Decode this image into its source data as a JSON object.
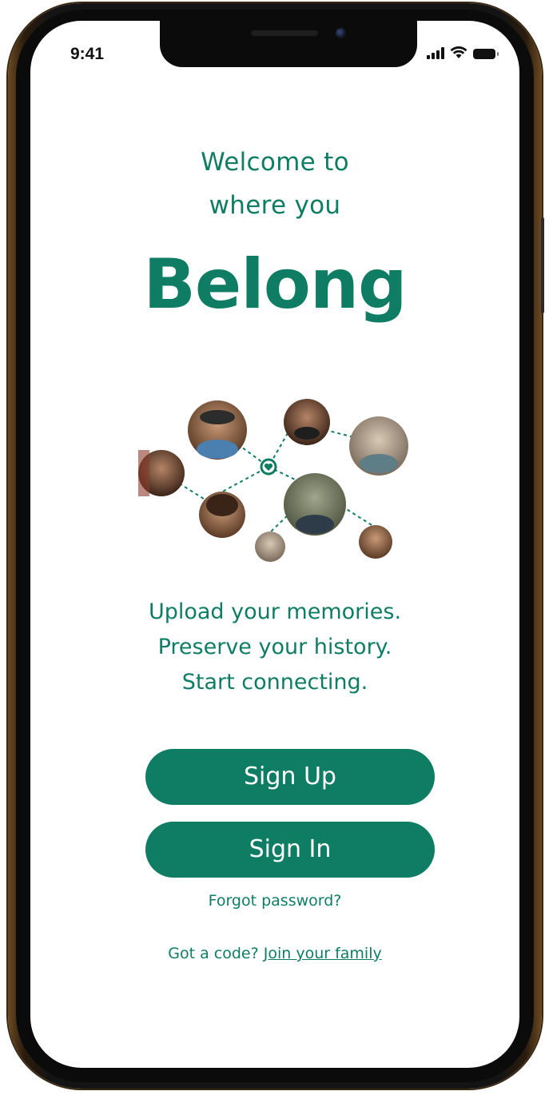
{
  "status_bar": {
    "time": "9:41",
    "icons": [
      "cellular-signal-icon",
      "wifi-icon",
      "battery-icon"
    ]
  },
  "welcome": {
    "line1": "Welcome to",
    "line2": "where you"
  },
  "brand": "Belong",
  "illustration": {
    "people": [
      "person-photo",
      "person-photo",
      "person-photo",
      "person-photo",
      "person-photo",
      "person-photo",
      "person-photo",
      "person-photo"
    ],
    "center_icon": "heart-icon"
  },
  "tagline": {
    "line1": "Upload your memories.",
    "line2": "Preserve your history.",
    "line3": "Start connecting."
  },
  "actions": {
    "sign_up": "Sign Up",
    "sign_in": "Sign In",
    "forgot_password": "Forgot password?",
    "code_prompt": "Got a code?",
    "join_family": "Join your family"
  },
  "colors": {
    "brand_green": "#0f7d63",
    "background": "#ffffff"
  }
}
